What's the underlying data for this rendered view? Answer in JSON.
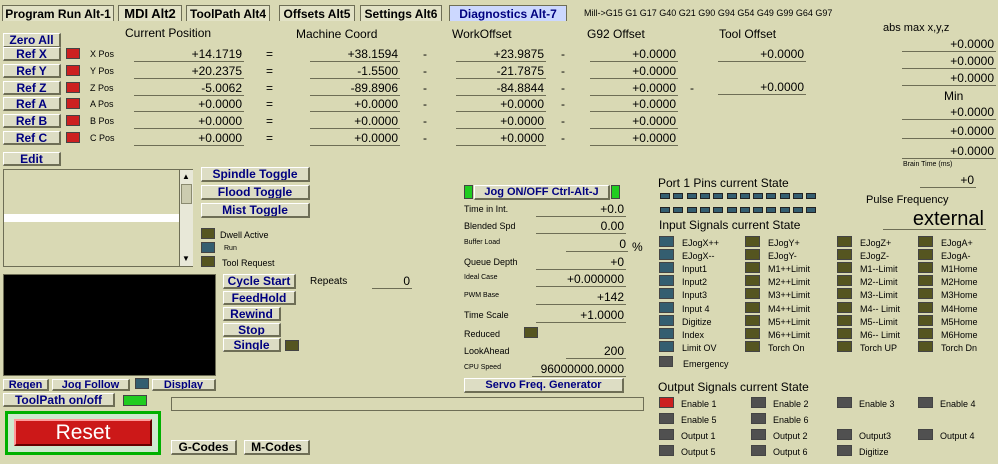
{
  "tabs": [
    {
      "label": "Program Run Alt-1",
      "active": false
    },
    {
      "label": "MDI Alt2",
      "active": false
    },
    {
      "label": "ToolPath Alt4",
      "active": false
    },
    {
      "label": "Offsets Alt5",
      "active": false
    },
    {
      "label": "Settings Alt6",
      "active": false
    },
    {
      "label": "Diagnostics Alt-7",
      "active": true
    }
  ],
  "modal_line": "Mill->G15  G1 G17 G40 G21 G90 G94 G54 G49 G99 G64 G97",
  "buttons": {
    "zero_all": "Zero All",
    "edit": "Edit",
    "spindle_toggle": "Spindle Toggle",
    "flood_toggle": "Flood Toggle",
    "mist_toggle": "Mist Toggle",
    "cycle_start": "Cycle Start",
    "feedhold": "FeedHold",
    "rewind": "Rewind",
    "stop": "Stop",
    "single": "Single",
    "regen": "Regen",
    "jog_follow": "Jog Follow",
    "display": "Display",
    "toolpath_onoff": "ToolPath on/off",
    "reset": "Reset",
    "gcodes": "G-Codes",
    "mcodes": "M-Codes",
    "jog_onoff": "Jog ON/OFF Ctrl-Alt-J",
    "servo": "Servo Freq. Generator"
  },
  "headers": {
    "current_position": "Current Position",
    "machine_coord": "Machine Coord",
    "work_offset": "WorkOffset",
    "g92_offset": "G92 Offset",
    "tool_offset": "Tool Offset",
    "abs_max": "abs max x,y,z",
    "min": "Min",
    "brain_time": "Brain Time (ms)"
  },
  "axes": [
    {
      "ref": "Ref X",
      "label": "X Pos",
      "current": "+14.1719",
      "machine": "+38.1594",
      "work": "+23.9875",
      "g92": "+0.0000",
      "op1": "=",
      "op2": "-",
      "op3": "-"
    },
    {
      "ref": "Ref Y",
      "label": "Y Pos",
      "current": "+20.2375",
      "machine": "-1.5500",
      "work": "-21.7875",
      "g92": "+0.0000",
      "op1": "=",
      "op2": "-",
      "op3": "-"
    },
    {
      "ref": "Ref Z",
      "label": "Z Pos",
      "current": "-5.0062",
      "machine": "-89.8906",
      "work": "-84.8844",
      "g92": "+0.0000",
      "op1": "=",
      "op2": "-",
      "op3": "-"
    },
    {
      "ref": "Ref A",
      "label": "A Pos",
      "current": "+0.0000",
      "machine": "+0.0000",
      "work": "+0.0000",
      "g92": "+0.0000",
      "op1": "=",
      "op2": "-",
      "op3": "-"
    },
    {
      "ref": "Ref B",
      "label": "B Pos",
      "current": "+0.0000",
      "machine": "+0.0000",
      "work": "+0.0000",
      "g92": "+0.0000",
      "op1": "=",
      "op2": "-",
      "op3": "-"
    },
    {
      "ref": "Ref C",
      "label": "C Pos",
      "current": "+0.0000",
      "machine": "+0.0000",
      "work": "+0.0000",
      "g92": "+0.0000",
      "op1": "=",
      "op2": "-",
      "op3": "-"
    }
  ],
  "tool_offset": [
    "+0.0000",
    "+0.0000"
  ],
  "tool_offset_op": "-",
  "abs_max": [
    "+0.0000",
    "+0.0000",
    "+0.0000"
  ],
  "min": [
    "+0.0000",
    "+0.0000",
    "+0.0000"
  ],
  "brain_time": "+0",
  "status_leds": [
    "Dwell Active",
    "Run",
    "Tool Request"
  ],
  "repeats": {
    "label": "Repeats",
    "value": "0"
  },
  "params": [
    {
      "label": "Time in Int.",
      "value": "+0.0",
      "small": false
    },
    {
      "label": "Blended Spd",
      "value": "0.00",
      "small": false
    },
    {
      "label": "Buffer Load",
      "value": "0",
      "small": true,
      "unit": "%"
    },
    {
      "label": "Queue Depth",
      "value": "+0",
      "small": false
    },
    {
      "label": "Ideal Case",
      "value": "+0.000000",
      "small": true
    },
    {
      "label": "PWM Base",
      "value": "+142",
      "small": true
    },
    {
      "label": "Time Scale",
      "value": "+1.0000",
      "small": false
    }
  ],
  "reduced_label": "Reduced",
  "lookahead": {
    "label": "LookAhead",
    "value": "200"
  },
  "cpu_speed": {
    "label": "CPU Speed",
    "value": "96000000.0000"
  },
  "port_state_title": "Port 1 Pins current State",
  "pulse_freq": {
    "label": "Pulse Frequency",
    "value": "external"
  },
  "input_title": "Input Signals current State",
  "inputs": [
    "EJogX++",
    "EJogY+",
    "EJogZ+",
    "EJogA+",
    "EJogX--",
    "EJogY-",
    "EJogZ-",
    "EJogA-",
    "Input1",
    "M1++Limit",
    "M1--Limit",
    "M1Home",
    "Input2",
    "M2++Limit",
    "M2--Limit",
    "M2Home",
    "Input3",
    "M3++Limit",
    "M3--Limit",
    "M3Home",
    "Input 4",
    "M4++Limit",
    "M4-- Limit",
    "M4Home",
    "Digitize",
    "M5++Limit",
    "M5--Limit",
    "M5Home",
    "Index",
    "M6++Limit",
    "M6-- Limit",
    "M6Home",
    "Limit OV",
    "Torch On",
    "Torch UP",
    "Torch Dn"
  ],
  "emergency": "Emergency",
  "output_title": "Output Signals current State",
  "outputs": [
    {
      "label": "Enable 1",
      "on": true
    },
    {
      "label": "Enable 2",
      "on": false
    },
    {
      "label": "Enable 3",
      "on": false
    },
    {
      "label": "Enable 4",
      "on": false
    },
    {
      "label": "Enable 5",
      "on": false
    },
    {
      "label": "Enable 6",
      "on": false
    },
    {
      "label": "Output 1",
      "on": false
    },
    {
      "label": "Output 2",
      "on": false
    },
    {
      "label": "Output3",
      "on": false
    },
    {
      "label": "Output 4",
      "on": false
    },
    {
      "label": "Output 5",
      "on": false
    },
    {
      "label": "Output 6",
      "on": false
    },
    {
      "label": "Digitize",
      "on": false
    }
  ],
  "colors": {
    "background": "#d9d9b4",
    "led_red": "#cc2020",
    "led_green": "#20cc20",
    "led_teal": "#345e70",
    "led_olive": "#555520",
    "reset_bg": "#cc1818",
    "reset_border": "#00b000",
    "active_tab": "#ccd8ff"
  }
}
